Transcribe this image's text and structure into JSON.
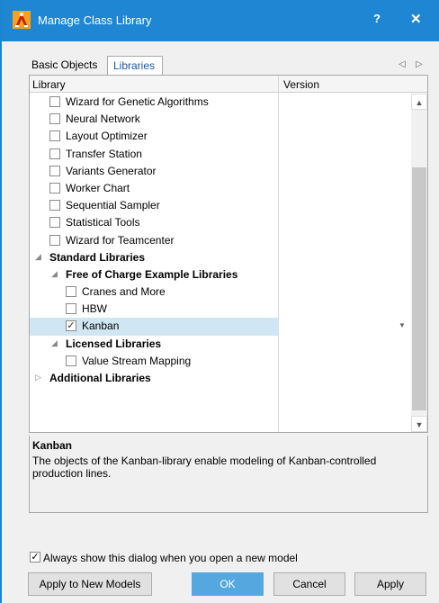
{
  "window": {
    "title": "Manage Class Library",
    "help_label": "?",
    "close_label": "✕",
    "title_color": "#1e86d2"
  },
  "tabs": [
    {
      "label": "Basic Objects",
      "active": false
    },
    {
      "label": "Libraries",
      "active": true
    }
  ],
  "tab_nav": {
    "prev": "◁",
    "next": "▷"
  },
  "grid": {
    "columns": [
      "Library",
      "Version"
    ],
    "rows": [
      {
        "label": "Wizard for Genetic Algorithms",
        "checked": false
      },
      {
        "label": "Neural Network",
        "checked": false
      },
      {
        "label": "Layout Optimizer",
        "checked": false
      },
      {
        "label": "Transfer Station",
        "checked": false
      },
      {
        "label": "Variants Generator",
        "checked": false
      },
      {
        "label": "Worker Chart",
        "checked": false
      },
      {
        "label": "Sequential Sampler",
        "checked": false
      },
      {
        "label": "Statistical Tools",
        "checked": false
      },
      {
        "label": "Wizard for Teamcenter",
        "checked": false
      },
      {
        "label": "Standard Libraries",
        "group": true,
        "expanded": true
      },
      {
        "label": "Free of Charge Example Libraries",
        "group": true,
        "expanded": true
      },
      {
        "label": "Cranes and More",
        "checked": false
      },
      {
        "label": "HBW",
        "checked": false
      },
      {
        "label": "Kanban",
        "checked": true,
        "selected": true
      },
      {
        "label": "Licensed Libraries",
        "group": true,
        "expanded": true
      },
      {
        "label": "Value Stream Mapping",
        "checked": false
      },
      {
        "label": "Additional Libraries",
        "group": true,
        "expanded": false
      }
    ]
  },
  "description": {
    "title": "Kanban",
    "text": "The objects of the Kanban-library enable modeling of Kanban-controlled production lines."
  },
  "always_show": {
    "checked": true,
    "label": "Always show this dialog when you open a new model"
  },
  "buttons": {
    "apply_new": "Apply to New Models",
    "ok": "OK",
    "cancel": "Cancel",
    "apply": "Apply"
  },
  "glyphs": {
    "check": "✓",
    "expanded": "◢",
    "collapsed": "▷",
    "scroll_up": "▲",
    "scroll_down": "▼",
    "dropdown": "▼"
  }
}
